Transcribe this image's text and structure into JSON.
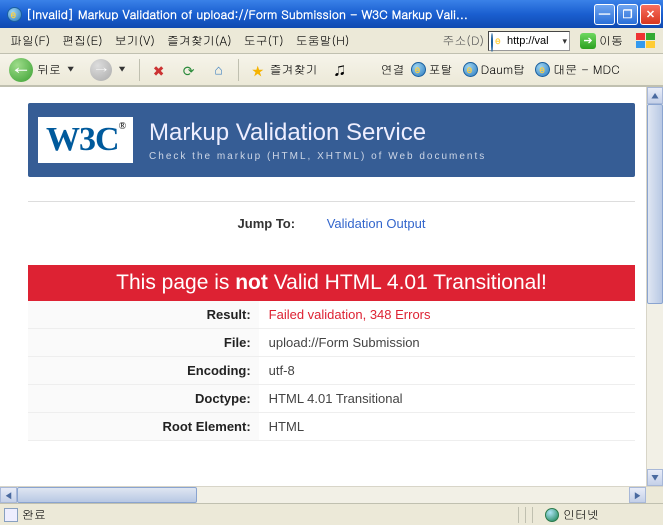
{
  "window": {
    "title": "[Invalid] Markup Validation of upload://Form Submission - W3C Markup Vali..."
  },
  "menu": {
    "file": "파일(F)",
    "edit": "편집(E)",
    "view": "보기(V)",
    "favorites": "즐겨찾기(A)",
    "tools": "도구(T)",
    "help": "도움말(H)",
    "address_label": "주소(D)",
    "address_value": "http://val",
    "go_label": "이동"
  },
  "toolbar": {
    "back_label": "뒤로",
    "favorites_label": "즐겨찾기",
    "links_label": "연결",
    "link1": "포탈",
    "link2": "Daum탑",
    "link3": "대문 - MDC"
  },
  "page": {
    "header_title": "Markup Validation Service",
    "header_sub": "Check the markup (HTML, XHTML) of Web documents",
    "jump_label": "Jump To:",
    "jump_link": "Validation Output",
    "banner_pre": "This page is ",
    "banner_not": "not",
    "banner_post": " Valid HTML 4.01 Transitional!",
    "rows": {
      "result_h": "Result:",
      "result_v": "Failed validation, 348 Errors",
      "file_h": "File:",
      "file_v": "upload://Form Submission",
      "encoding_h": "Encoding:",
      "encoding_v": "utf-8",
      "doctype_h": "Doctype:",
      "doctype_v": "HTML 4.01 Transitional",
      "root_h": "Root Element:",
      "root_v": "HTML"
    }
  },
  "status": {
    "done": "완료",
    "zone": "인터넷"
  }
}
